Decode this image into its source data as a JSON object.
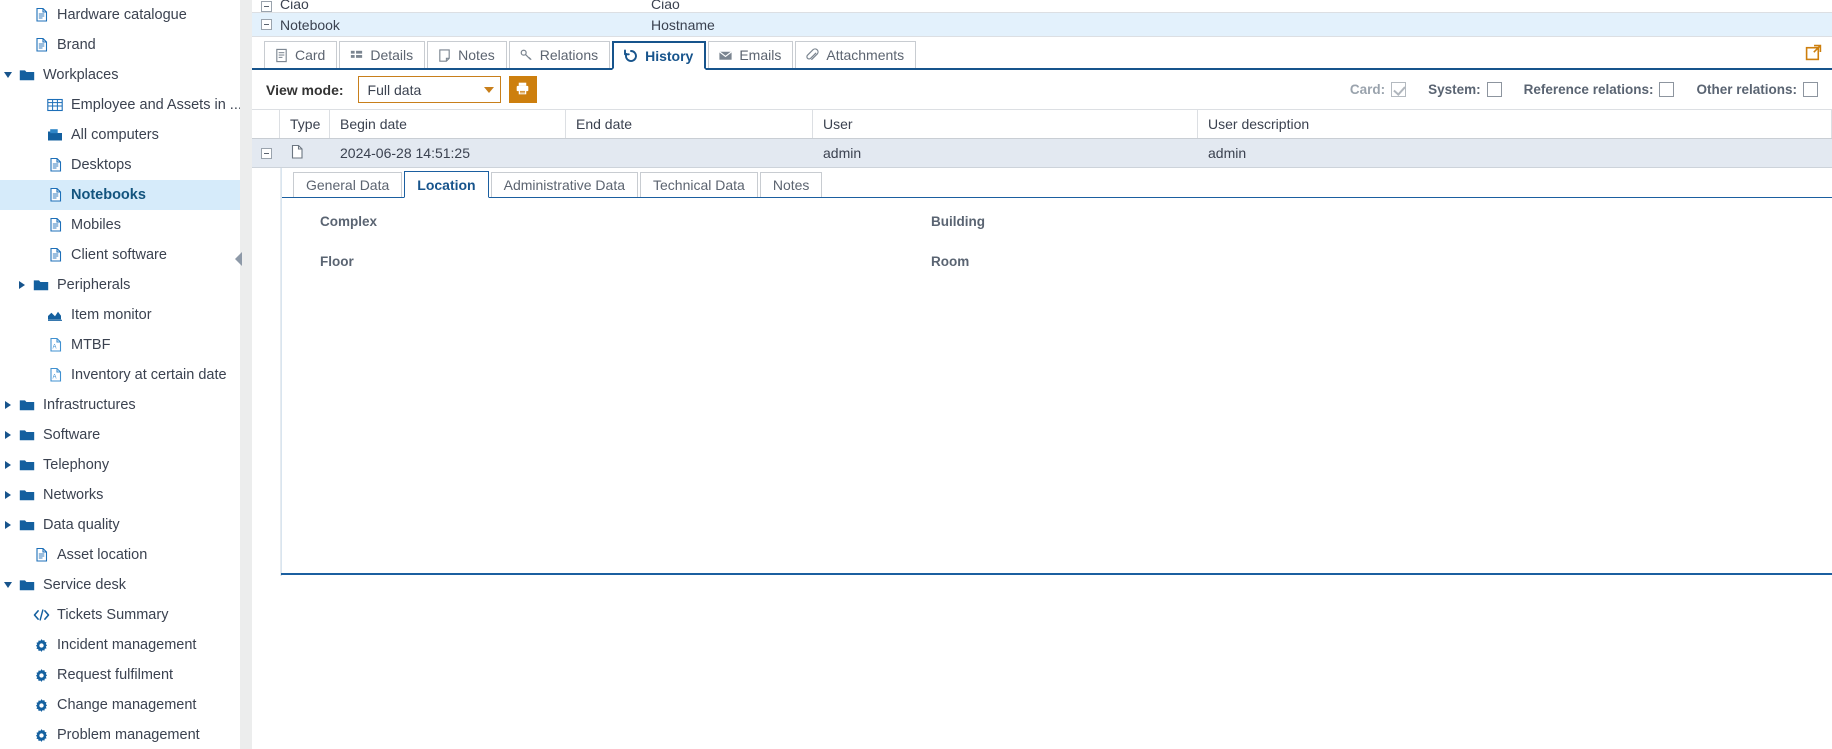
{
  "sidebar": {
    "items": [
      {
        "label": "Hardware catalogue",
        "icon": "document-icon",
        "indent": 1,
        "twisty": "none",
        "selected": false
      },
      {
        "label": "Brand",
        "icon": "document-icon",
        "indent": 1,
        "twisty": "none",
        "selected": false
      },
      {
        "label": "Workplaces",
        "icon": "folder-icon",
        "indent": 0,
        "twisty": "down",
        "selected": false
      },
      {
        "label": "Employee and Assets in ...",
        "icon": "table-icon",
        "indent": 2,
        "twisty": "none",
        "selected": false
      },
      {
        "label": "All computers",
        "icon": "report-icon",
        "indent": 2,
        "twisty": "none",
        "selected": false
      },
      {
        "label": "Desktops",
        "icon": "document-icon",
        "indent": 2,
        "twisty": "none",
        "selected": false
      },
      {
        "label": "Notebooks",
        "icon": "document-icon",
        "indent": 2,
        "twisty": "none",
        "selected": true
      },
      {
        "label": "Mobiles",
        "icon": "document-icon",
        "indent": 2,
        "twisty": "none",
        "selected": false
      },
      {
        "label": "Client software",
        "icon": "document-icon",
        "indent": 2,
        "twisty": "none",
        "selected": false
      },
      {
        "label": "Peripherals",
        "icon": "folder-icon",
        "indent": 1,
        "twisty": "right",
        "selected": false
      },
      {
        "label": "Item monitor",
        "icon": "chart-icon",
        "indent": 2,
        "twisty": "none",
        "selected": false
      },
      {
        "label": "MTBF",
        "icon": "pdf-icon",
        "indent": 2,
        "twisty": "none",
        "selected": false
      },
      {
        "label": "Inventory at certain date",
        "icon": "pdf-icon",
        "indent": 2,
        "twisty": "none",
        "selected": false
      },
      {
        "label": "Infrastructures",
        "icon": "folder-icon",
        "indent": 0,
        "twisty": "right",
        "selected": false
      },
      {
        "label": "Software",
        "icon": "folder-icon",
        "indent": 0,
        "twisty": "right",
        "selected": false
      },
      {
        "label": "Telephony",
        "icon": "folder-icon",
        "indent": 0,
        "twisty": "right",
        "selected": false
      },
      {
        "label": "Networks",
        "icon": "folder-icon",
        "indent": 0,
        "twisty": "right",
        "selected": false
      },
      {
        "label": "Data quality",
        "icon": "folder-icon",
        "indent": 0,
        "twisty": "right",
        "selected": false
      },
      {
        "label": "Asset location",
        "icon": "document-icon",
        "indent": 1,
        "twisty": "none",
        "selected": false
      },
      {
        "label": "Service desk",
        "icon": "folder-icon",
        "indent": 0,
        "twisty": "down",
        "selected": false
      },
      {
        "label": "Tickets Summary",
        "icon": "code-icon",
        "indent": 1,
        "twisty": "none",
        "selected": false
      },
      {
        "label": "Incident management",
        "icon": "gear-icon",
        "indent": 1,
        "twisty": "none",
        "selected": false
      },
      {
        "label": "Request fulfilment",
        "icon": "gear-icon",
        "indent": 1,
        "twisty": "none",
        "selected": false
      },
      {
        "label": "Change management",
        "icon": "gear-icon",
        "indent": 1,
        "twisty": "none",
        "selected": false
      },
      {
        "label": "Problem management",
        "icon": "gear-icon",
        "indent": 1,
        "twisty": "none",
        "selected": false
      }
    ]
  },
  "records": [
    {
      "col1": "Ciao",
      "col2": "Ciao",
      "selected": false
    },
    {
      "col1": "Notebook",
      "col2": "Hostname",
      "selected": true
    }
  ],
  "tabs": [
    {
      "label": "Card",
      "icon": "card-icon",
      "active": false
    },
    {
      "label": "Details",
      "icon": "details-icon",
      "active": false
    },
    {
      "label": "Notes",
      "icon": "notes-icon",
      "active": false
    },
    {
      "label": "Relations",
      "icon": "relations-icon",
      "active": false
    },
    {
      "label": "History",
      "icon": "history-icon",
      "active": true
    },
    {
      "label": "Emails",
      "icon": "email-icon",
      "active": false
    },
    {
      "label": "Attachments",
      "icon": "attachment-icon",
      "active": false
    }
  ],
  "toolbar": {
    "view_mode_label": "View mode:",
    "view_mode_value": "Full data",
    "print_icon": "printer-icon",
    "external_link_icon": "external-link-icon",
    "checkboxes": [
      {
        "label": "Card:",
        "checked": true,
        "disabled": true
      },
      {
        "label": "System:",
        "checked": false,
        "disabled": false
      },
      {
        "label": "Reference relations:",
        "checked": false,
        "disabled": false
      },
      {
        "label": "Other relations:",
        "checked": false,
        "disabled": false
      }
    ]
  },
  "grid": {
    "columns": [
      "",
      "Type",
      "Begin date",
      "End date",
      "User",
      "User description"
    ],
    "rows": [
      {
        "expander": "minus",
        "type_icon": "file-icon",
        "begin_date": "2024-06-28 14:51:25",
        "end_date": "",
        "user": "admin",
        "user_description": "admin"
      }
    ]
  },
  "detail": {
    "tabs": [
      {
        "label": "General Data",
        "active": false
      },
      {
        "label": "Location",
        "active": true
      },
      {
        "label": "Administrative Data",
        "active": false
      },
      {
        "label": "Technical Data",
        "active": false
      },
      {
        "label": "Notes",
        "active": false
      }
    ],
    "fields": [
      {
        "left_label": "Complex",
        "left_value": "",
        "right_label": "Building",
        "right_value": ""
      },
      {
        "left_label": "Floor",
        "left_value": "",
        "right_label": "Room",
        "right_value": ""
      }
    ]
  },
  "colors": {
    "accent_blue": "#17548c",
    "accent_orange": "#cd7f0e",
    "selection_blue": "#d6ebfa",
    "row_selected": "#e3f1fc",
    "grid_row": "#e3e9f1"
  }
}
